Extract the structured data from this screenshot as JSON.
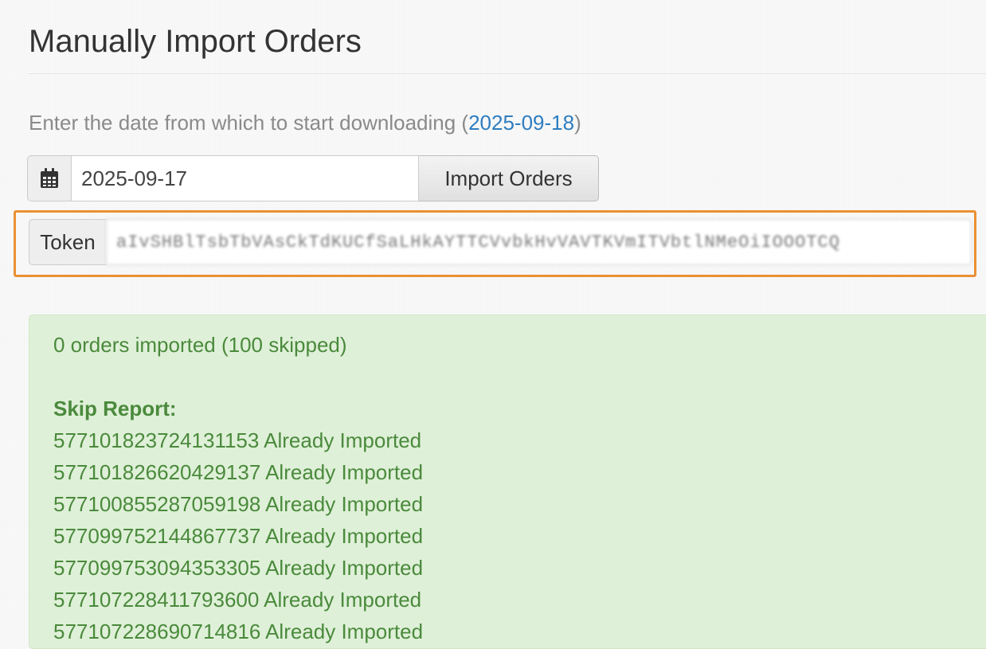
{
  "page": {
    "title": "Manually Import Orders",
    "instruction_prefix": "Enter the date from which to start downloading (",
    "instruction_link": "2025-09-18",
    "instruction_suffix": ")"
  },
  "date_form": {
    "calendar_icon": "calendar-icon",
    "date_value": "2025-09-17",
    "import_button_label": "Import Orders"
  },
  "token_form": {
    "label": "Token",
    "value": "aIvSHBlTsbTbVAsCkTdKUCfSaLHkAYTTCVvbkHvVAVTKVmITVbtlNMeOiIOOOTCQ",
    "highlight_color": "#eb9033"
  },
  "result": {
    "summary": "0 orders imported (100 skipped)",
    "skip_heading": "Skip Report:",
    "skipped": [
      {
        "id": "577101823724131153",
        "status": "Already Imported"
      },
      {
        "id": "577101826620429137",
        "status": "Already Imported"
      },
      {
        "id": "577100855287059198",
        "status": "Already Imported"
      },
      {
        "id": "577099752144867737",
        "status": "Already Imported"
      },
      {
        "id": "577099753094353305",
        "status": "Already Imported"
      },
      {
        "id": "577107228411793600",
        "status": "Already Imported"
      },
      {
        "id": "577107228690714816",
        "status": "Already Imported"
      }
    ]
  },
  "colors": {
    "link": "#2e7dc0",
    "success_text": "#4a8a3c",
    "success_bg": "#dff0d8"
  }
}
